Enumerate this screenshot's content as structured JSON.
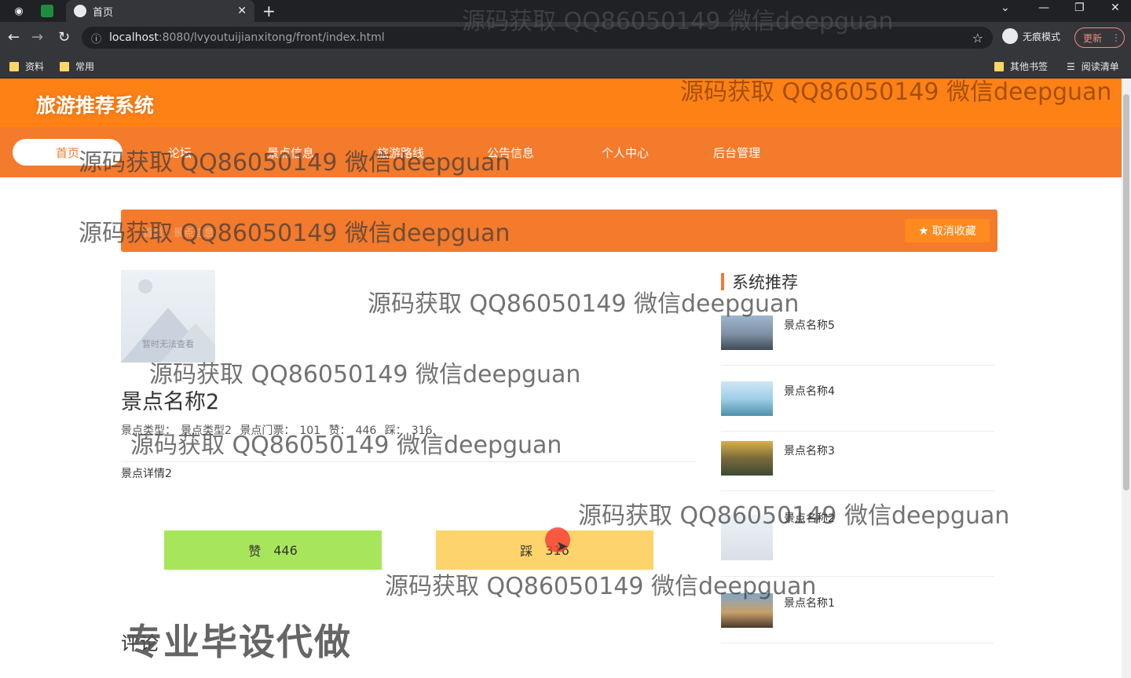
{
  "browser": {
    "tab_title": "首页",
    "new_tab": "+",
    "url_host": "localhost",
    "url_path": ":8080/lvyoutuijianxitong/front/index.html",
    "incognito_label": "无痕模式",
    "update_label": "更新",
    "bookmarks": [
      "资料",
      "常用"
    ],
    "bookmarks_right": [
      "其他书签",
      "阅读清单"
    ]
  },
  "site": {
    "title": "旅游推荐系统",
    "nav": [
      "首页",
      "论坛",
      "景点信息",
      "旅游路线",
      "公告信息",
      "个人中心",
      "后台管理"
    ]
  },
  "breadcrumb": "首页 / 景点信息",
  "favorite_button": "取消收藏",
  "detail": {
    "image_caption": "暂时无法查看",
    "title": "景点名称2",
    "type_label": "景点类型：",
    "type_value": "景点类型2",
    "ticket_label": "景点门票：",
    "ticket_value": "101",
    "like_label": "赞：",
    "like_value": "446",
    "dislike_label": "踩：",
    "dislike_value": "316",
    "description": "景点详情2"
  },
  "buttons": {
    "like_label": "赞",
    "like_count": "446",
    "dislike_label": "踩",
    "dislike_count": "316"
  },
  "comments_label": "评论",
  "promo": "专业毕设代做",
  "sidebar": {
    "heading": "系统推荐",
    "items": [
      {
        "name": "景点名称5"
      },
      {
        "name": "景点名称4"
      },
      {
        "name": "景点名称3"
      },
      {
        "name": "景点名称2"
      },
      {
        "name": "景点名称1"
      }
    ]
  },
  "watermark": "源码获取 QQ86050149 微信deepguan",
  "colors": {
    "header_orange": "#fe8116",
    "nav_orange": "#f47a2c",
    "like_green": "#a7e65a",
    "dislike_yellow": "#fdd36b"
  }
}
